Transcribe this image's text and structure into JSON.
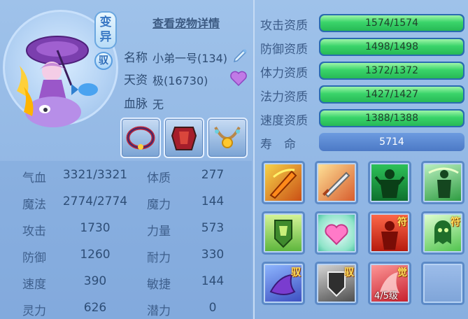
{
  "pet": {
    "detail_link": "查看宠物详情",
    "badge_variant": "变异",
    "badge_tame": "驭",
    "labels": {
      "name": "名称",
      "aptitude": "天资",
      "bloodline": "血脉"
    },
    "name": "小弟一号(134)",
    "aptitude": "极(16730)",
    "bloodline": "无"
  },
  "stats": [
    {
      "label": "气血",
      "value": "3321/3321"
    },
    {
      "label": "体质",
      "value": "277"
    },
    {
      "label": "魔法",
      "value": "2774/2774"
    },
    {
      "label": "魔力",
      "value": "144"
    },
    {
      "label": "攻击",
      "value": "1730"
    },
    {
      "label": "力量",
      "value": "573"
    },
    {
      "label": "防御",
      "value": "1260"
    },
    {
      "label": "耐力",
      "value": "330"
    },
    {
      "label": "速度",
      "value": "390"
    },
    {
      "label": "敏捷",
      "value": "144"
    },
    {
      "label": "灵力",
      "value": "626"
    },
    {
      "label": "潜力",
      "value": "0"
    }
  ],
  "aptitudes": [
    {
      "label": "攻击资质",
      "text": "1574/1574",
      "fraction": 1.0
    },
    {
      "label": "防御资质",
      "text": "1498/1498",
      "fraction": 1.0
    },
    {
      "label": "体力资质",
      "text": "1372/1372",
      "fraction": 1.0
    },
    {
      "label": "法力资质",
      "text": "1427/1427",
      "fraction": 1.0
    },
    {
      "label": "速度资质",
      "text": "1388/1388",
      "fraction": 1.0
    }
  ],
  "life": {
    "label": "寿　命",
    "value": "5714"
  },
  "skills": {
    "tags": {
      "fu": "符",
      "yu": "驭",
      "jue": "觉"
    },
    "level_text": "4/5级"
  },
  "colors": {
    "bar_fill": "#3ad46a",
    "bar_bg": "#2a6bb0",
    "panel_bg": "#9fc2ea"
  }
}
